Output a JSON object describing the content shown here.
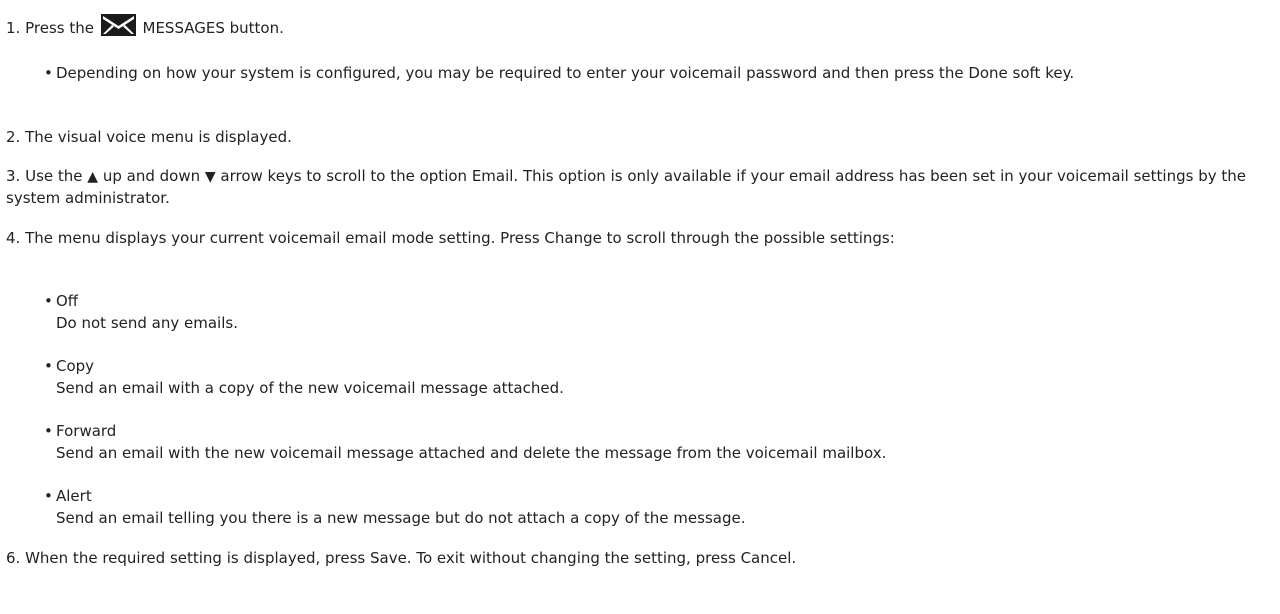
{
  "steps": [
    {
      "num": "1.",
      "pre": "Press the ",
      "icon": "envelope-icon",
      "post": " MESSAGES button."
    },
    {
      "num": "2.",
      "text": "The visual voice menu is displayed."
    },
    {
      "num": "3.",
      "part1": "Use the ",
      "up_arrow": "▲",
      "part2": " up and down ",
      "down_arrow": "▼",
      "part3": " arrow keys to scroll to the option Email. This option is only available if your email address has been set in your voicemail settings by the system administrator."
    },
    {
      "num": "4.",
      "text": "The menu displays your current voicemail email mode setting. Press Change to scroll through the possible settings:"
    },
    {
      "num": "6.",
      "text": "When the required setting is displayed, press Save. To exit without changing the setting, press Cancel."
    }
  ],
  "step1_note": "Depending on how your system is configured, you may be required to enter your voicemail password and then press the Done soft key.",
  "bullet_symbol": "•",
  "settings": [
    {
      "name": "Off",
      "desc": "Do not send any emails."
    },
    {
      "name": "Copy",
      "desc": "Send an email with a copy of the new voicemail message attached."
    },
    {
      "name": "Forward",
      "desc": "Send an email with the new voicemail message attached and delete the message from the voicemail mailbox."
    },
    {
      "name": "Alert",
      "desc": "Send an email telling you there is a new message but do not attach a copy of the message."
    }
  ],
  "colors": {
    "text": "#222222",
    "icon_fill": "#1a1a1a"
  }
}
